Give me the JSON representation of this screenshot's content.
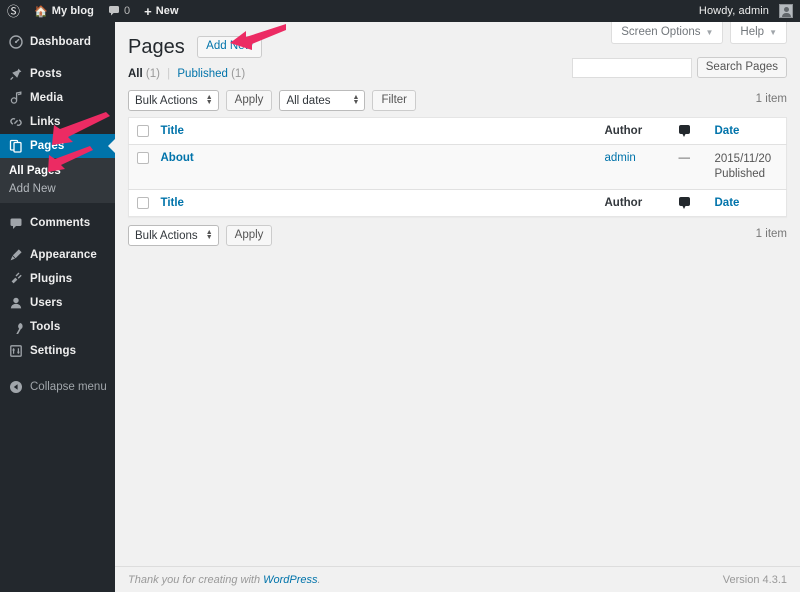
{
  "colors": {
    "adminbar_bg": "#23282d",
    "sidebar_bg": "#23282d",
    "submenu_bg": "#32373c",
    "accent_blue": "#0073aa",
    "content_bg": "#f1f1f1",
    "link_blue": "#0073aa",
    "arrow_pink": "#ec2b63"
  },
  "adminbar": {
    "wp_logo_icon": "wordpress-logo-icon",
    "site_home_icon": "home-icon",
    "site_name": "My blog",
    "comments_icon": "comment-bubble-icon",
    "comments_count": "0",
    "new_icon": "plus-icon",
    "new_label": "New",
    "howdy": "Howdy, admin",
    "avatar_icon": "avatar-icon"
  },
  "sidebar": {
    "items": [
      {
        "label": "Dashboard",
        "icon": "dashboard-icon",
        "current": false
      },
      {
        "label": "Posts",
        "icon": "pin-icon",
        "current": false
      },
      {
        "label": "Media",
        "icon": "media-icon",
        "current": false
      },
      {
        "label": "Links",
        "icon": "link-icon",
        "current": false
      },
      {
        "label": "Pages",
        "icon": "pages-icon",
        "current": true
      },
      {
        "label": "Comments",
        "icon": "comment-bubble-icon",
        "current": false
      },
      {
        "label": "Appearance",
        "icon": "appearance-brush-icon",
        "current": false
      },
      {
        "label": "Plugins",
        "icon": "plugins-plug-icon",
        "current": false
      },
      {
        "label": "Users",
        "icon": "users-icon",
        "current": false
      },
      {
        "label": "Tools",
        "icon": "tools-wrench-icon",
        "current": false
      },
      {
        "label": "Settings",
        "icon": "settings-sliders-icon",
        "current": false
      }
    ],
    "pages_submenu": [
      {
        "label": "All Pages",
        "current": true
      },
      {
        "label": "Add New",
        "current": false
      }
    ],
    "collapse": {
      "label": "Collapse menu",
      "icon": "collapse-arrow-icon"
    }
  },
  "screen_meta": {
    "screen_options_label": "Screen Options",
    "help_label": "Help",
    "caret_icon": "chevron-down-icon"
  },
  "header": {
    "title": "Pages",
    "add_new_label": "Add New"
  },
  "views": {
    "all_label": "All",
    "all_count": "(1)",
    "divider": "|",
    "published_label": "Published",
    "published_count": "(1)"
  },
  "search": {
    "value": "",
    "placeholder": "",
    "button_label": "Search Pages"
  },
  "tablenav_top": {
    "bulk_actions_value": "Bulk Actions",
    "apply_label": "Apply",
    "dates_value": "All dates",
    "filter_label": "Filter",
    "count_label": "1 item"
  },
  "tablenav_bottom": {
    "bulk_actions_value": "Bulk Actions",
    "apply_label": "Apply",
    "count_label": "1 item"
  },
  "table": {
    "columns": {
      "select_all": "",
      "title": "Title",
      "author": "Author",
      "comments_icon": "comment-bubble-icon",
      "date": "Date"
    },
    "rows": [
      {
        "title": "About",
        "author": "admin",
        "comments": "—",
        "date": "2015/11/20",
        "status": "Published"
      }
    ]
  },
  "footer": {
    "thanks_prefix": "Thank you for creating with ",
    "wordpress_link": "WordPress",
    "thanks_suffix": ".",
    "version": "Version 4.3.1"
  },
  "annotations": {
    "arrows": [
      {
        "name": "arrow-to-add-new",
        "target": "Add New button"
      },
      {
        "name": "arrow-to-pages-menu",
        "target": "Pages menu item"
      },
      {
        "name": "arrow-to-all-pages",
        "target": "All Pages submenu item"
      }
    ]
  }
}
